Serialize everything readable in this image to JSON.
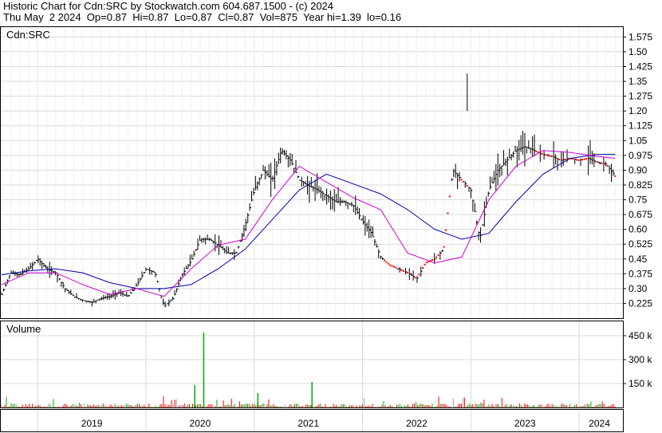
{
  "header": {
    "line1": "Historic Chart for Cdn:SRC by Stockwatch.com 604.687.1500 - (c) 2024",
    "line2": "Thu May  2 2024  Op=0.87  Hi=0.87  Lo=0.87  Cl=0.87  Vol=875  Year hi=1.39  lo=0.16"
  },
  "chart_data": [
    {
      "type": "candlestick",
      "title": "Cdn:SRC",
      "y_scale": "linear",
      "ylim": [
        0.15,
        1.625
      ],
      "y_ticks": [
        "1.575",
        "1.50",
        "1.425",
        "1.35",
        "1.275",
        "1.20",
        "1.125",
        "1.05",
        "0.975",
        "0.90",
        "0.825",
        "0.75",
        "0.675",
        "0.60",
        "0.525",
        "0.45",
        "0.375",
        "0.30",
        "0.225"
      ],
      "x_labels": [
        "2019",
        "2020",
        "2021",
        "2022",
        "2023",
        "2024"
      ],
      "grid": true,
      "colors": {
        "price_bar": "#000000",
        "ma_short": "#cc00cc",
        "ma_long": "#0000aa",
        "tick_dot": "#ff0000"
      },
      "series": [
        {
          "name": "close",
          "x": [
            "2018-09",
            "2018-10",
            "2018-11",
            "2018-12",
            "2019-01",
            "2019-02",
            "2019-03",
            "2019-04",
            "2019-05",
            "2019-06",
            "2019-07",
            "2019-08",
            "2019-09",
            "2019-10",
            "2019-11",
            "2019-12",
            "2020-01",
            "2020-02",
            "2020-03",
            "2020-04",
            "2020-05",
            "2020-06",
            "2020-07",
            "2020-08",
            "2020-09",
            "2020-10",
            "2020-11",
            "2020-12",
            "2021-01",
            "2021-02",
            "2021-03",
            "2021-04",
            "2021-05",
            "2021-06",
            "2021-07",
            "2021-08",
            "2021-09",
            "2021-10",
            "2021-11",
            "2021-12",
            "2022-01",
            "2022-02",
            "2022-03",
            "2022-04",
            "2022-05",
            "2022-06",
            "2022-07",
            "2022-08",
            "2022-09",
            "2022-10",
            "2022-11",
            "2022-12",
            "2023-01",
            "2023-02",
            "2023-03",
            "2023-04",
            "2023-05",
            "2023-06",
            "2023-07",
            "2023-08",
            "2023-09",
            "2023-10",
            "2023-11",
            "2023-12",
            "2024-01",
            "2024-02",
            "2024-03",
            "2024-04",
            "2024-05"
          ],
          "values": [
            0.27,
            0.38,
            0.37,
            0.4,
            0.45,
            0.4,
            0.38,
            0.3,
            0.26,
            0.24,
            0.23,
            0.25,
            0.26,
            0.28,
            0.26,
            0.32,
            0.4,
            0.38,
            0.21,
            0.25,
            0.37,
            0.44,
            0.55,
            0.55,
            0.52,
            0.48,
            0.48,
            0.62,
            0.8,
            0.9,
            0.85,
            1.0,
            0.95,
            0.85,
            0.82,
            0.8,
            0.77,
            0.74,
            0.74,
            0.72,
            0.64,
            0.58,
            0.46,
            0.42,
            0.4,
            0.38,
            0.35,
            0.43,
            0.45,
            0.5,
            0.9,
            0.85,
            0.8,
            0.55,
            0.8,
            0.9,
            0.95,
            1.0,
            1.02,
            1.0,
            0.98,
            0.97,
            0.95,
            0.96,
            0.95,
            0.96,
            0.94,
            0.93,
            0.87
          ]
        },
        {
          "name": "ma_short",
          "x": [
            "2018-09",
            "2018-12",
            "2019-03",
            "2019-06",
            "2019-09",
            "2019-12",
            "2020-03",
            "2020-06",
            "2020-09",
            "2020-12",
            "2021-03",
            "2021-06",
            "2021-09",
            "2021-12",
            "2022-03",
            "2022-06",
            "2022-09",
            "2022-12",
            "2023-03",
            "2023-06",
            "2023-09",
            "2023-12",
            "2024-03",
            "2024-05"
          ],
          "values": [
            0.32,
            0.38,
            0.38,
            0.32,
            0.27,
            0.3,
            0.26,
            0.4,
            0.52,
            0.55,
            0.75,
            0.92,
            0.84,
            0.76,
            0.7,
            0.48,
            0.43,
            0.46,
            0.75,
            0.92,
            1.0,
            0.99,
            0.97,
            0.96
          ]
        },
        {
          "name": "ma_long",
          "x": [
            "2018-09",
            "2018-12",
            "2019-03",
            "2019-06",
            "2019-09",
            "2019-12",
            "2020-03",
            "2020-06",
            "2020-09",
            "2020-12",
            "2021-03",
            "2021-06",
            "2021-09",
            "2021-12",
            "2022-03",
            "2022-06",
            "2022-09",
            "2022-12",
            "2023-03",
            "2023-06",
            "2023-09",
            "2023-12",
            "2024-03",
            "2024-05"
          ],
          "values": [
            0.37,
            0.39,
            0.4,
            0.38,
            0.33,
            0.3,
            0.3,
            0.32,
            0.4,
            0.5,
            0.65,
            0.8,
            0.88,
            0.83,
            0.78,
            0.7,
            0.6,
            0.55,
            0.58,
            0.74,
            0.88,
            0.96,
            0.98,
            0.98
          ]
        }
      ]
    },
    {
      "type": "bar",
      "title": "Volume",
      "ylim": [
        0,
        520000
      ],
      "y_ticks": [
        "450 k",
        "300 k",
        "150 k"
      ],
      "colors": {
        "up": "#00aa00",
        "down": "#ff0000",
        "flat": "#999999"
      },
      "spikes": [
        {
          "x": "2020-07",
          "value": 470000
        },
        {
          "x": "2020-06",
          "value": 140000
        },
        {
          "x": "2021-07",
          "value": 160000
        },
        {
          "x": "2021-01",
          "value": 90000
        }
      ]
    }
  ]
}
